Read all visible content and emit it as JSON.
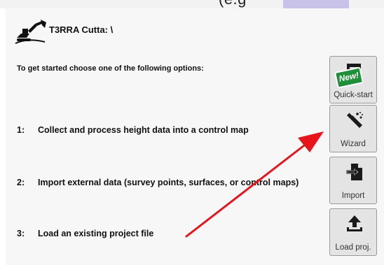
{
  "top": {
    "text": "(e.g ",
    "highlight": "hlp"
  },
  "app": {
    "title": "T3RRA Cutta: \\"
  },
  "intro": "To get started choose one of the following options:",
  "options": [
    {
      "num": "1:",
      "label": "Collect and process height data into a control map"
    },
    {
      "num": "2:",
      "label": "Import external data (survey points, surfaces, or control maps)"
    },
    {
      "num": "3:",
      "label": "Load an existing project file"
    }
  ],
  "buttons": {
    "quickstart": {
      "label": "Quick-start",
      "badge": "New!",
      "icon": "chat-bubble-icon"
    },
    "wizard": {
      "label": "Wizard",
      "icon": "magic-wand-icon"
    },
    "import": {
      "label": "Import",
      "icon": "file-import-icon"
    },
    "load": {
      "label": "Load proj.",
      "icon": "upload-icon"
    }
  },
  "colors": {
    "highlight": "#c9c2e8",
    "badge": "#1f8f3a",
    "arrow": "#e8141b",
    "button_bg": "#e4e4e4"
  }
}
